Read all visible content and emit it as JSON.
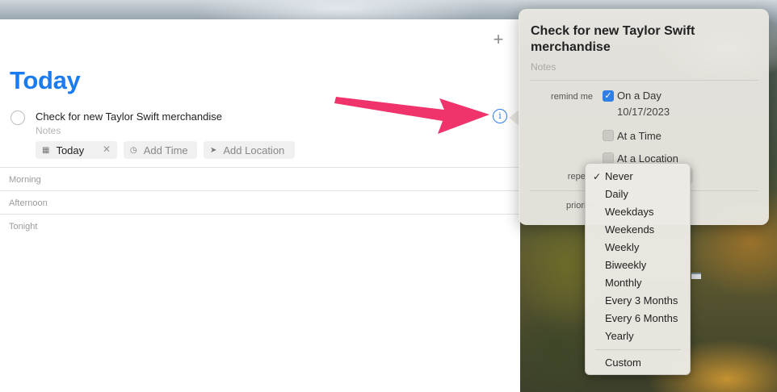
{
  "app": {
    "page_title": "Today",
    "add_icon_glyph": "+"
  },
  "task": {
    "title": "Check for new Taylor Swift merchandise",
    "notes_placeholder": "Notes",
    "chips": {
      "today_label": "Today",
      "add_time_label": "Add Time",
      "add_location_label": "Add Location"
    }
  },
  "sections": [
    "Morning",
    "Afternoon",
    "Tonight"
  ],
  "popover": {
    "title": "Check for new Taylor Swift merchandise",
    "notes_placeholder": "Notes",
    "remind_me_label": "remind me",
    "on_a_day_label": "On a Day",
    "on_a_day_checked": true,
    "date": "10/17/2023",
    "at_a_time_label": "At a Time",
    "at_a_location_label": "At a Location",
    "repeat_label": "repeat",
    "priority_label": "priority"
  },
  "repeat_menu": {
    "selected": "Never",
    "items": [
      "Never",
      "Daily",
      "Weekdays",
      "Weekends",
      "Weekly",
      "Biweekly",
      "Monthly",
      "Every 3 Months",
      "Every 6 Months",
      "Yearly"
    ],
    "custom_label": "Custom"
  },
  "colors": {
    "accent": "#1b7cf2",
    "annotation_arrow": "#f0336a"
  }
}
